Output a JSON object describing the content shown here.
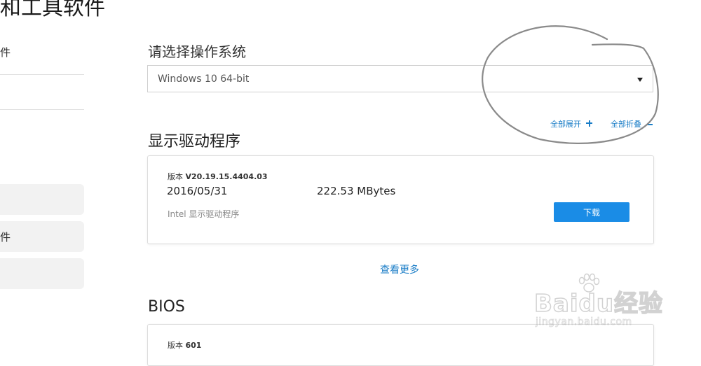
{
  "page": {
    "heading": "和工具软件"
  },
  "sidebar": {
    "item1": "件",
    "item2": "件"
  },
  "os_selector": {
    "label": "请选择操作系统",
    "selected": "Windows 10 64-bit"
  },
  "controls": {
    "expand_all": "全部展开",
    "collapse_all": "全部折叠"
  },
  "display_driver": {
    "title": "显示驱动程序",
    "version_prefix": "版本",
    "version": "V20.19.15.4404.03",
    "date": "2016/05/31",
    "size": "222.53 MBytes",
    "description": "Intel 显示驱动程序",
    "download_label": "下载"
  },
  "view_more": "查看更多",
  "bios": {
    "title": "BIOS",
    "version_prefix": "版本",
    "version": "601"
  },
  "watermark": {
    "brand": "Baidu经验",
    "url": "jingyan.baidu.com"
  },
  "colors": {
    "accent": "#1a8ce6",
    "link": "#1a7dc7",
    "border": "#dcdcdc"
  }
}
